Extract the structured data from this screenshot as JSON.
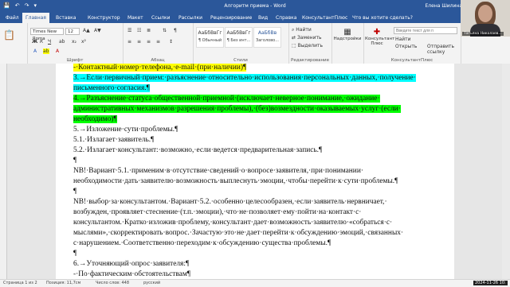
{
  "window": {
    "title": "Алгоритм приема  -  Word",
    "user": "Елена Шилина",
    "qat": [
      "💾",
      "↶",
      "↷",
      "▾"
    ]
  },
  "tabs": [
    "Файл",
    "Главная",
    "Вставка",
    "Конструктор",
    "Макет",
    "Ссылки",
    "Рассылки",
    "Рецензирование",
    "Вид",
    "Справка",
    "КонсультантПлюс",
    "Что вы хотите сделать?"
  ],
  "ribbon": {
    "font_name": "Times New Roma",
    "font_size": "12",
    "groups": [
      "Шрифт",
      "Абзац",
      "Стили",
      "Редактирование",
      "КонсультантПлюс"
    ],
    "styles": [
      {
        "sample": "АаБбВвГг",
        "name": "¶ Обычный"
      },
      {
        "sample": "АаБбВвГг",
        "name": "¶ Без инт..."
      },
      {
        "sample": "АаБбВв",
        "name": "Заголово..."
      }
    ],
    "editing": [
      "Найти",
      "Заменить",
      "Выделить"
    ],
    "addins_label": "Надстройки",
    "consultant_label": "Консультант Плюс",
    "search_placeholder": "Введите текст для п",
    "search_btn": "Найти",
    "open_btn": "Открыть",
    "send_link": "Отправить ссылку"
  },
  "document": {
    "lines": [
      {
        "text": "-·Контактный·номер·телефона,·e-mail·(при·наличии)¶",
        "hl": "y"
      },
      {
        "text": "3.→Если·первичный·прием:·разъяснение·относительно·использования·персональных·данных,·получение·",
        "hl": "c"
      },
      {
        "text": "письменного·согласия.¶",
        "hl": "c"
      },
      {
        "text": "4.→Разъяснение·статуса·общественной·приемной·(исключает·неверное·понимание,·ожидание·",
        "hl": "g"
      },
      {
        "text": "административных·механизмов·разрешения·проблемы),·(без)возмездности·оказываемых·услуг·(если·",
        "hl": "g"
      },
      {
        "text": "необходимо)¶",
        "hl": "g"
      },
      {
        "text": "5.→Изложение·сути·проблемы.¶",
        "hl": ""
      },
      {
        "text": "5.1.·Излагает·заявитель.¶",
        "hl": ""
      },
      {
        "text": "5.2.·Излагает·консультант:·возможно,·если·ведется·предварительная·запись.¶",
        "hl": ""
      },
      {
        "text": "¶",
        "hl": ""
      },
      {
        "text": "NB!·Вариант·5.1.·применим·в·отсутствие·сведений·о·вопросе·заявителя,·при·понимании·",
        "hl": ""
      },
      {
        "text": "необходимости·дать·заявителю·возможность·выплеснуть·эмоции,·чтобы·перейти·к·сути·проблемы.¶",
        "hl": ""
      },
      {
        "text": "¶",
        "hl": ""
      },
      {
        "text": "NB!·выбор·за·консультантом.·Вариант·5.2.·особенно·целесообразен,·если·заявитель·нервничает,·",
        "hl": ""
      },
      {
        "text": "возбужден,·проявляет·стеснение·(т.п.·эмоции),·что·не·позволяет·ему·пойти·на·контакт·с·",
        "hl": ""
      },
      {
        "text": "консультантом.·Кратко·изложив·проблему,·консультант·дает·возможность·заявителю·«собраться·с·",
        "hl": ""
      },
      {
        "text": "мыслями»,·скорректировать·вопрос.·Зачастую·это·не·дает·перейти·к·обсуждению·эмоций,·связанных·",
        "hl": ""
      },
      {
        "text": "с·нарушением.·Соответственно·переходим·к·обсуждению·существа·проблемы.¶",
        "hl": ""
      },
      {
        "text": "¶",
        "hl": ""
      },
      {
        "text": "6.→Уточняющий·опрос·заявителя:¶",
        "hl": ""
      },
      {
        "text": "-·По·фактическим·обстоятельствам¶",
        "hl": ""
      }
    ]
  },
  "status": {
    "page": "Страница 1 из 2",
    "position": "Позиция: 11,7см",
    "words": "Число слов: 448",
    "lang": "русский"
  },
  "webcam_label": "Татьяна Николаев...",
  "taskbar": {
    "time": "2024-11-26 10:"
  }
}
